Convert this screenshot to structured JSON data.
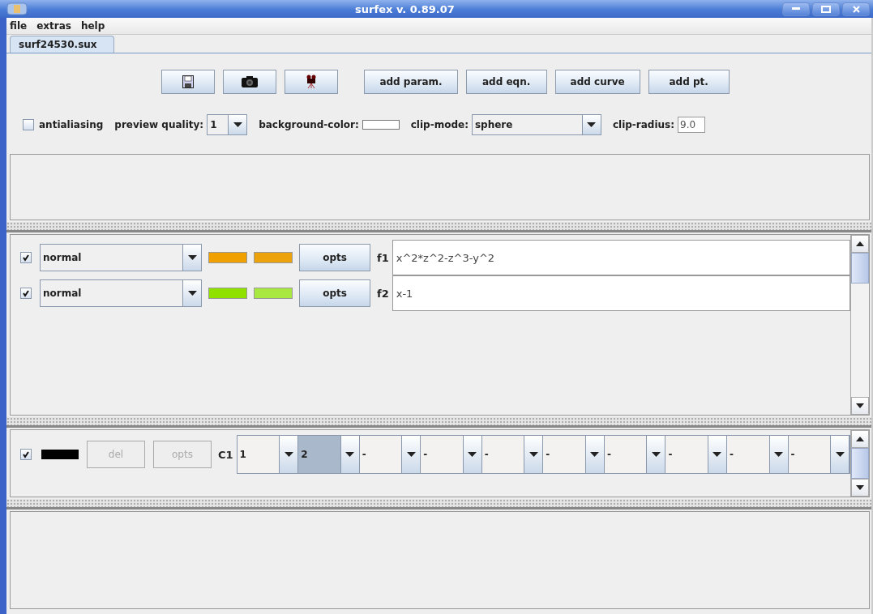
{
  "window": {
    "title": "surfex v. 0.89.07"
  },
  "menu": [
    "file",
    "extras",
    "help"
  ],
  "tabs": [
    {
      "label": "surf24530.sux",
      "selected": true
    }
  ],
  "buttons": [
    "add param.",
    "add eqn.",
    "add curve",
    "add pt."
  ],
  "options": {
    "antialiasing": {
      "label": "antialiasing",
      "checked": false
    },
    "preview_quality": {
      "label": "preview quality:",
      "value": "1"
    },
    "background_color": {
      "label": "background-color:"
    },
    "clip_mode": {
      "label": "clip-mode:",
      "value": "sphere"
    },
    "clip_radius": {
      "label": "clip-radius:",
      "value": "9.0"
    }
  },
  "equations": [
    {
      "checked": true,
      "mode": "normal",
      "swatches": [
        {
          "color": "#f0a000"
        },
        {
          "color": "#eca20a"
        }
      ],
      "button": "opts",
      "label": "f1",
      "value": "x^2*z^2-z^3-y^2"
    },
    {
      "checked": true,
      "mode": "normal",
      "swatches": [
        {
          "color": "#90e000"
        },
        {
          "color": "#a8e840"
        }
      ],
      "button": "opts",
      "label": "f2",
      "value": "x-1"
    }
  ],
  "curves": [
    {
      "checked": true,
      "color": "#000000",
      "buttons": [
        {
          "label": "del",
          "disabled": true
        },
        {
          "label": "opts",
          "disabled": true
        }
      ],
      "label": "C1",
      "selectors": [
        {
          "value": "1",
          "selected": false
        },
        {
          "value": "2",
          "selected": true
        },
        {
          "value": "-",
          "selected": false
        },
        {
          "value": "-",
          "selected": false
        },
        {
          "value": "-",
          "selected": false
        },
        {
          "value": "-",
          "selected": false
        },
        {
          "value": "-",
          "selected": false
        },
        {
          "value": "-",
          "selected": false
        },
        {
          "value": "-",
          "selected": false
        },
        {
          "value": "-",
          "selected": false
        }
      ]
    }
  ]
}
